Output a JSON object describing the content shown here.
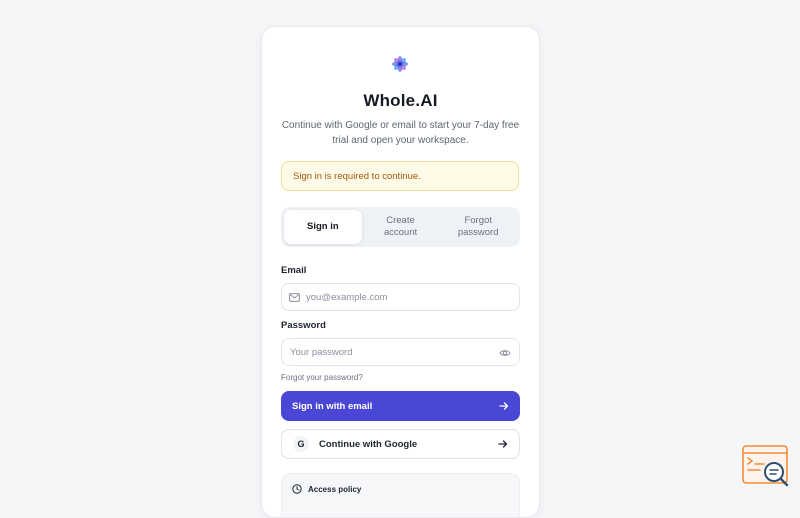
{
  "app": {
    "title": "Whole.AI",
    "subtitle": "Continue with Google or email to start your 7-day free trial and open your workspace."
  },
  "alert": {
    "text": "Sign in is required to continue."
  },
  "tabs": [
    {
      "label": "Sign in",
      "active": true
    },
    {
      "label": "Create account",
      "active": false
    },
    {
      "label": "Forgot password",
      "active": false
    }
  ],
  "form": {
    "email_label": "Email",
    "email_placeholder": "you@example.com",
    "email_value": "",
    "password_label": "Password",
    "password_placeholder": "Your password",
    "password_value": "",
    "forgot_link": "Forgot your password?"
  },
  "buttons": {
    "email_signin": "Sign in with email",
    "google_badge": "G",
    "google": "Continue with Google"
  },
  "policy": {
    "title": "Access policy"
  },
  "icons": {
    "logo": "flower-logo-icon",
    "email": "mail-icon",
    "password_toggle": "eye-icon",
    "arrow": "arrow-right-icon",
    "policy": "clock-icon",
    "widget": "search-code-icon"
  },
  "colors": {
    "primary": "#4a47d6",
    "alert_bg": "#fff9e8",
    "alert_border": "#f6df98",
    "alert_text": "#9a5a0a",
    "widget_accent": "#f28c3b"
  }
}
